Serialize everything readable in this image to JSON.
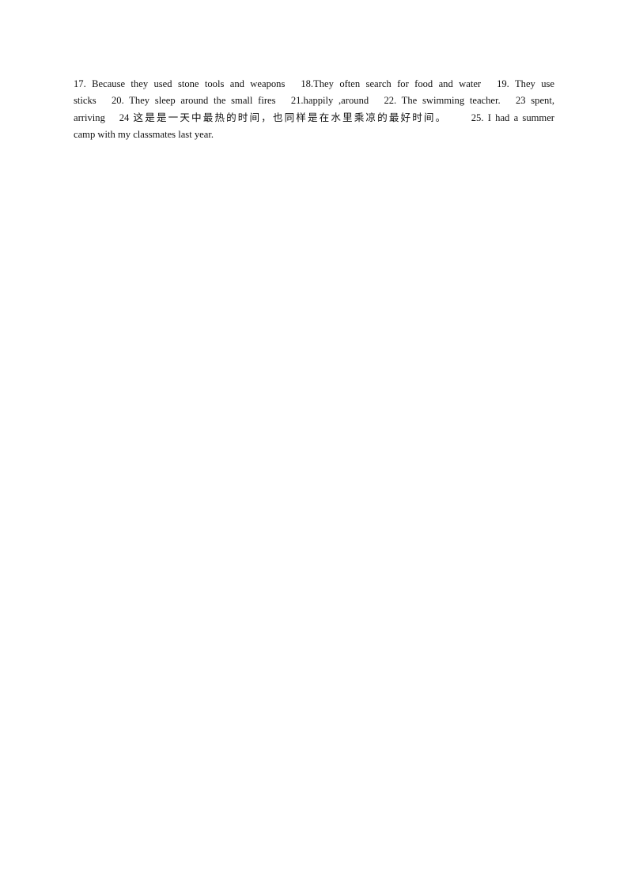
{
  "document": {
    "answers": [
      {
        "number": "17.",
        "text": "Because they used stone tools and weapons"
      },
      {
        "number": "18.",
        "text": "They often search for food and water"
      },
      {
        "number": "19.",
        "text": "They use sticks"
      },
      {
        "number": "20.",
        "text": "They sleep around the small fires"
      },
      {
        "number": "21.",
        "text": "happily ,around"
      },
      {
        "number": "22.",
        "text": "The swimming teacher."
      },
      {
        "number": "23",
        "text": "spent, arriving"
      },
      {
        "number": "24",
        "text": "这是是一天中最热的时间，也同样是在水里乘凉的最好时间。"
      },
      {
        "number": "25.",
        "text": "I had a summer camp with my classmates last year."
      }
    ],
    "lines": [
      "17. Because they used stone tools and weapons  18.They often search for food and water  19. They use",
      "sticks  20. They sleep around the small fires  21.happily ,around  22. The swimming teacher.  23 spent,",
      "arriving  24  这是是一天中最热的时间，也同样是在水里乘凉的最好时间。   25. I had a summer",
      "camp with my classmates last year."
    ]
  }
}
